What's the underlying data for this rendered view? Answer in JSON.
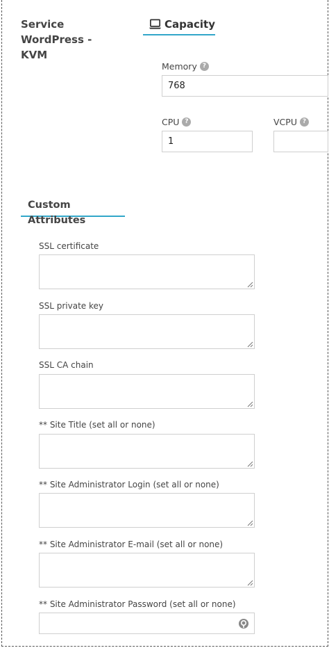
{
  "service": {
    "title": "Service WordPress - KVM"
  },
  "capacity": {
    "tab_label": "Capacity",
    "memory": {
      "label": "Memory",
      "value": "768"
    },
    "cpu": {
      "label": "CPU",
      "value": "1"
    },
    "vcpu": {
      "label": "VCPU",
      "value": ""
    },
    "help_glyph": "?"
  },
  "custom_attributes": {
    "title": "Custom Attributes",
    "fields": [
      {
        "label": "SSL certificate",
        "value": ""
      },
      {
        "label": "SSL private key",
        "value": ""
      },
      {
        "label": "SSL CA chain",
        "value": ""
      },
      {
        "label": "** Site Title (set all or none)",
        "value": ""
      },
      {
        "label": "** Site Administrator Login (set all or none)",
        "value": ""
      },
      {
        "label": "** Site Administrator E-mail (set all or none)",
        "value": ""
      },
      {
        "label": "** Site Administrator Password (set all or none)",
        "value": ""
      }
    ]
  },
  "colors": {
    "accent": "#31a6c9",
    "border": "#cfcfcf",
    "help_icon": "#aaaaaa"
  },
  "icons": [
    "laptop-icon",
    "help-icon",
    "resize-grip-icon",
    "password-key-icon"
  ]
}
